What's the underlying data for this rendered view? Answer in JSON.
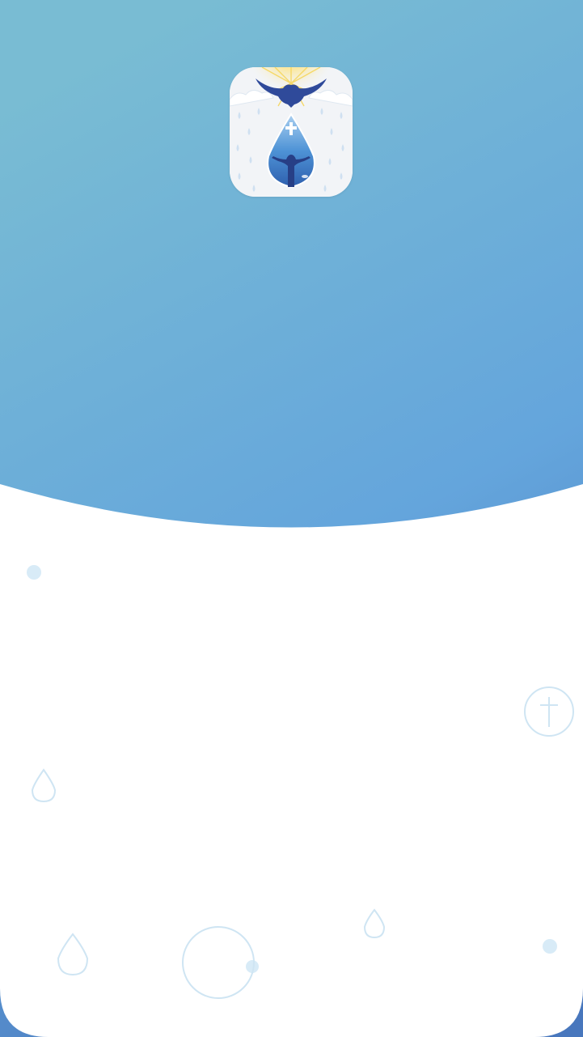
{
  "screen": {
    "name": "splash",
    "colors": {
      "header_top": "#79bcd3",
      "header_mid": "#64a5dc",
      "header_bottom": "#4877bd",
      "panel": "#ffffff",
      "decor_fill": "#d8ebf7",
      "decor_stroke": "#cfe5f3"
    }
  },
  "app_icon": {
    "icon": "dove-water-drop-cross-icon",
    "colors": {
      "background": "#f2f4f7",
      "dove": "#2f4a9a",
      "rays": "#f7e07a",
      "drop": "#3f86cc",
      "cross": "#ffffff"
    }
  },
  "decorations": {
    "icons": [
      "dot-icon",
      "cross-circle-icon",
      "water-drop-outline-icon",
      "circle-outline-icon"
    ]
  }
}
